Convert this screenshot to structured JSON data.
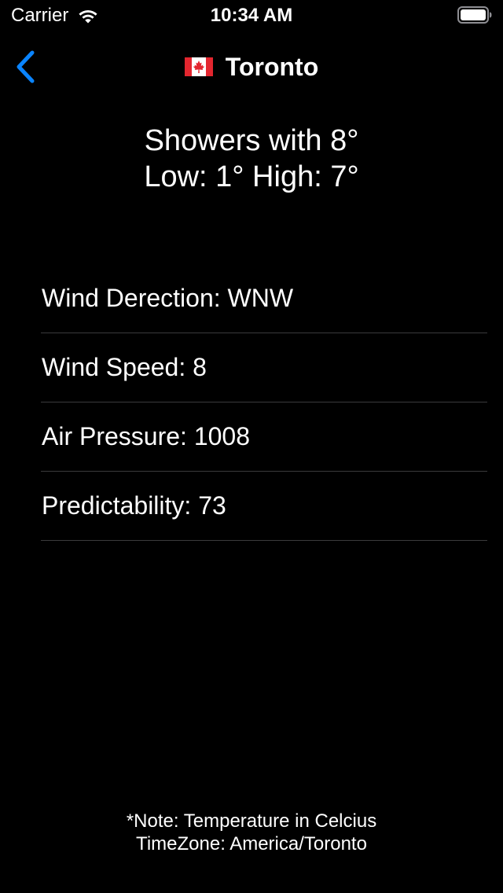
{
  "status_bar": {
    "carrier": "Carrier",
    "time": "10:34 AM"
  },
  "nav": {
    "title": "Toronto",
    "accent_color": "#0a84ff"
  },
  "summary": {
    "condition_line": "Showers with 8°",
    "range_line": "Low: 1° High: 7°"
  },
  "details": [
    {
      "text": "Wind Derection: WNW"
    },
    {
      "text": "Wind Speed: 8"
    },
    {
      "text": "Air Pressure: 1008"
    },
    {
      "text": "Predictability: 73"
    }
  ],
  "footer": {
    "note": "*Note: Temperature in Celcius",
    "timezone": "TimeZone: America/Toronto"
  },
  "icons": {
    "back": "chevron-left-icon",
    "flag": "canada-flag-icon",
    "wifi": "wifi-icon",
    "battery": "battery-icon"
  }
}
